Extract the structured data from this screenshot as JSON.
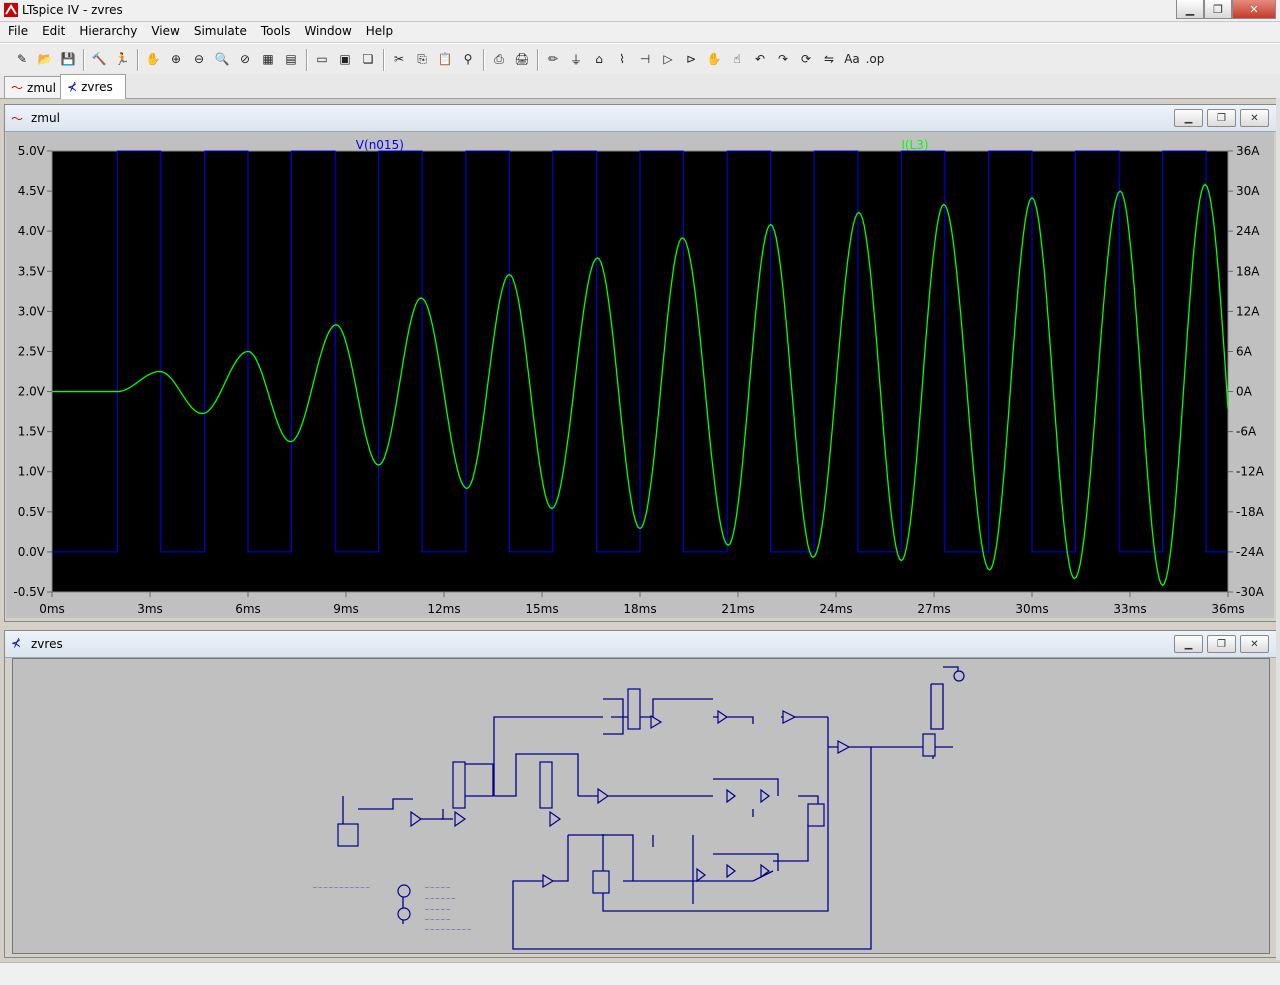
{
  "window": {
    "title": "LTspice IV - zvres",
    "min": "0",
    "max": "1",
    "close": "r"
  },
  "menu": [
    "File",
    "Edit",
    "Hierarchy",
    "View",
    "Simulate",
    "Tools",
    "Window",
    "Help"
  ],
  "toolbar_icons": [
    "new-schematic-icon",
    "open-icon",
    "save-icon",
    "control-panel-icon",
    "run-icon",
    "halt-icon",
    "zoom-in-icon",
    "zoom-out-icon",
    "zoom-fit-icon",
    "zoom-cancel-icon",
    "autorange-icon",
    "pan-icon",
    "tile-horizontal-icon",
    "tile-vertical-icon",
    "cascade-icon",
    "cut-icon",
    "copy-icon",
    "paste-icon",
    "find-icon",
    "print-setup-icon",
    "print-icon",
    "wire-icon",
    "ground-icon",
    "label-icon",
    "resistor-icon",
    "capacitor-icon",
    "diode-icon",
    "component-icon",
    "move-icon",
    "drag-icon",
    "undo-icon",
    "redo-icon",
    "rotate-icon",
    "mirror-icon",
    "text-icon",
    "spice-directive-icon"
  ],
  "tabs": [
    {
      "label": "zmul"
    },
    {
      "label": "zvres"
    }
  ],
  "plot_window": {
    "title": "zmul"
  },
  "schematic_window": {
    "title": "zvres"
  },
  "colors": {
    "trace1": "#0000ff",
    "trace2": "#00ff00",
    "plot_bg": "#000000",
    "axis_text": "#c0c0c0",
    "schem_bg": "#c0c0c0"
  },
  "chart_data": {
    "type": "line",
    "series": [
      {
        "name": "V(n015)",
        "color": "#0000ff",
        "axis": "left",
        "description_shape": "square wave 0V to 5V, period ~2.67ms, begins at 2ms"
      },
      {
        "name": "I(L3)",
        "color": "#00ff00",
        "axis": "right",
        "description_shape": "growing sinusoid"
      }
    ],
    "x": {
      "label": "",
      "unit": "ms",
      "min": 0,
      "max": 36,
      "ticks": [
        "0ms",
        "3ms",
        "6ms",
        "9ms",
        "12ms",
        "15ms",
        "18ms",
        "21ms",
        "24ms",
        "27ms",
        "30ms",
        "33ms",
        "36ms"
      ]
    },
    "y_left": {
      "min": -0.5,
      "max": 5.0,
      "ticks": [
        "5.0V",
        "4.5V",
        "4.0V",
        "3.5V",
        "3.0V",
        "2.5V",
        "2.0V",
        "1.5V",
        "1.0V",
        "0.5V",
        "0.0V",
        "-0.5V"
      ]
    },
    "y_right": {
      "min": -30,
      "max": 36,
      "ticks": [
        "36A",
        "30A",
        "24A",
        "18A",
        "12A",
        "6A",
        "0A",
        "-6A",
        "-12A",
        "-18A",
        "-24A",
        "-30A"
      ]
    },
    "square_wave": {
      "low": 0.0,
      "high": 5.0,
      "edges_ms": [
        2.0,
        3.33,
        4.67,
        6.0,
        7.33,
        8.67,
        10.0,
        11.33,
        12.67,
        14.0,
        15.33,
        16.67,
        18.0,
        19.33,
        20.67,
        22.0,
        23.33,
        24.67,
        26.0,
        27.33,
        28.67,
        30.0,
        31.33,
        32.67,
        34.0,
        35.33
      ]
    },
    "sine_peaks": [
      {
        "x_ms": 3.3,
        "amp_A": 3.0
      },
      {
        "x_ms": 4.6,
        "amp_A": -3.3
      },
      {
        "x_ms": 6.0,
        "amp_A": 6.0
      },
      {
        "x_ms": 7.3,
        "amp_A": -7.5
      },
      {
        "x_ms": 8.7,
        "amp_A": 10.0
      },
      {
        "x_ms": 10.0,
        "amp_A": -11.0
      },
      {
        "x_ms": 11.3,
        "amp_A": 14.0
      },
      {
        "x_ms": 12.7,
        "amp_A": -14.5
      },
      {
        "x_ms": 14.0,
        "amp_A": 17.5
      },
      {
        "x_ms": 15.3,
        "amp_A": -17.5
      },
      {
        "x_ms": 16.7,
        "amp_A": 20.0
      },
      {
        "x_ms": 18.0,
        "amp_A": -20.5
      },
      {
        "x_ms": 19.3,
        "amp_A": 23.0
      },
      {
        "x_ms": 20.7,
        "amp_A": -23.0
      },
      {
        "x_ms": 22.0,
        "amp_A": 25.0
      },
      {
        "x_ms": 23.3,
        "amp_A": -24.8
      },
      {
        "x_ms": 24.7,
        "amp_A": 26.8
      },
      {
        "x_ms": 26.0,
        "amp_A": -25.3
      },
      {
        "x_ms": 27.3,
        "amp_A": 28.0
      },
      {
        "x_ms": 28.7,
        "amp_A": -26.7
      },
      {
        "x_ms": 30.0,
        "amp_A": 29.0
      },
      {
        "x_ms": 31.3,
        "amp_A": -28.0
      },
      {
        "x_ms": 32.7,
        "amp_A": 30.0
      },
      {
        "x_ms": 34.0,
        "amp_A": -29.0
      },
      {
        "x_ms": 35.3,
        "amp_A": 31.0
      }
    ],
    "sine_start_ms": 2.0,
    "grid": false
  }
}
